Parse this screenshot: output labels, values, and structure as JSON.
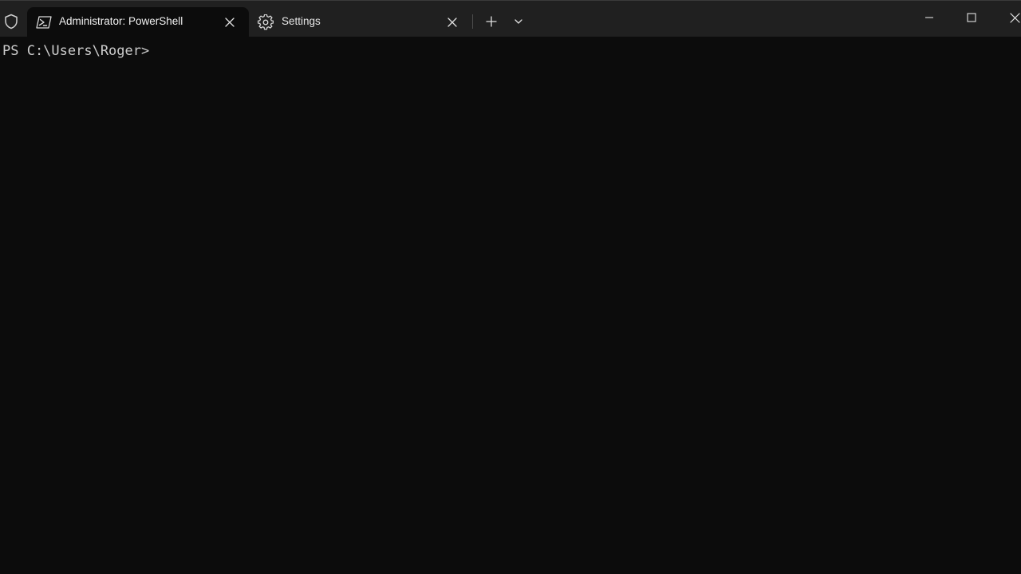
{
  "window": {
    "tabs": [
      {
        "label": "Administrator: PowerShell",
        "icon": "powershell-icon",
        "active": true
      },
      {
        "label": "Settings",
        "icon": "gear-icon",
        "active": false
      }
    ],
    "controls": {
      "new_tab_icon": "plus-icon",
      "dropdown_icon": "chevron-down-icon",
      "minimize_icon": "minimize-icon",
      "maximize_icon": "maximize-icon",
      "close_icon": "close-icon"
    }
  },
  "terminal": {
    "prompt": "PS C:\\Users\\Roger>"
  },
  "colors": {
    "titlebar": "#202020",
    "terminal_bg": "#0c0c0c",
    "text": "#cccccc"
  }
}
